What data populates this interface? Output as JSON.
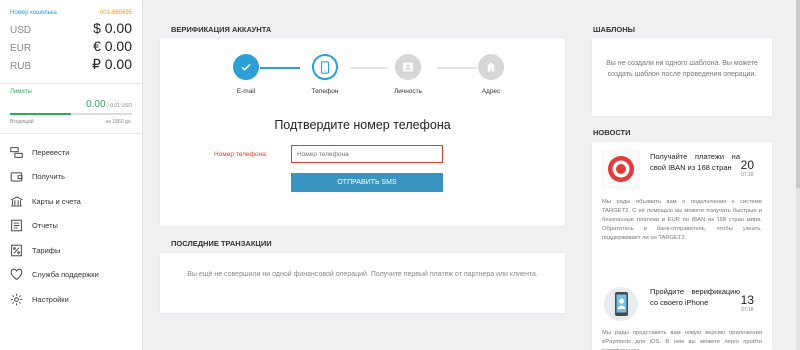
{
  "wallet": {
    "label": "Номер кошелька",
    "number": "001-860695",
    "balances": [
      {
        "currency": "USD",
        "amount": "$ 0.00"
      },
      {
        "currency": "EUR",
        "amount": "€ 0.00"
      },
      {
        "currency": "RUB",
        "amount": "₽ 0.00"
      }
    ]
  },
  "limits": {
    "title": "Лимиты",
    "value": "0.00",
    "max": "/ 0.01 USD",
    "fill_fraction": 0.5,
    "left_label": "Входящий",
    "right_label": "на 1860 дн."
  },
  "menu": [
    {
      "icon": "transfer-icon",
      "label": "Перевести"
    },
    {
      "icon": "wallet-icon",
      "label": "Получить"
    },
    {
      "icon": "card-icon",
      "label": "Карты и счета"
    },
    {
      "icon": "document-icon",
      "label": "Отчеты"
    },
    {
      "icon": "percent-icon",
      "label": "Тарифы"
    },
    {
      "icon": "heart-icon",
      "label": "Служба поддержки"
    },
    {
      "icon": "gear-icon",
      "label": "Настройки"
    }
  ],
  "verification": {
    "title": "ВЕРИФИКАЦИЯ АККАУНТА",
    "steps": [
      {
        "label": "E-mail",
        "icon": "check-icon",
        "state": "done"
      },
      {
        "label": "Телефон",
        "icon": "phone-icon",
        "state": "active"
      },
      {
        "label": "Личность",
        "icon": "id-card-icon",
        "state": "pending"
      },
      {
        "label": "Адрес",
        "icon": "home-icon",
        "state": "pending"
      }
    ],
    "heading": "Подтвердите номер телефона",
    "phone_label": "Номер телефона:",
    "phone_placeholder": "Номер телефона",
    "send_button": "ОТПРАВИТЬ SMS"
  },
  "transactions": {
    "title": "ПОСЛЕДНИЕ ТРАНЗАКЦИИ",
    "empty_text": "Вы ещё не совершили ни одной финансовой операций. Получите первый платеж от партнера или клиента."
  },
  "templates": {
    "title": "ШАБЛОНЫ",
    "empty_text": "Вы не создали ни одного шаблона. Вы можете создать шаблон после проведения операции."
  },
  "news": {
    "title": "НОВОСТИ",
    "items": [
      {
        "title": "Получайте платежи на свой IBAN из 168 стран",
        "day": "20",
        "month": "07.18",
        "body": "Мы рады объявить вам о подключении к системе TARGET2. С её помощью вы можете получать быстрые и безопасные платежи в EUR по IBAN из 168 стран мира. Обратитесь в банк-отправитель, чтобы узнать, поддерживает ли он TARGET2."
      },
      {
        "title": "Пройдите верификацию со своего iPhone",
        "day": "13",
        "month": "07.18",
        "body": "Мы рады представить вам новую версию приложения ePayments для iOS. В нем вы можете легко пройти верификацию..."
      }
    ]
  },
  "colors": {
    "accent": "#2b9fd6",
    "button": "#3a94c2",
    "error": "#d84333",
    "success": "#3aa55d",
    "pending": "#d7d7d7"
  }
}
